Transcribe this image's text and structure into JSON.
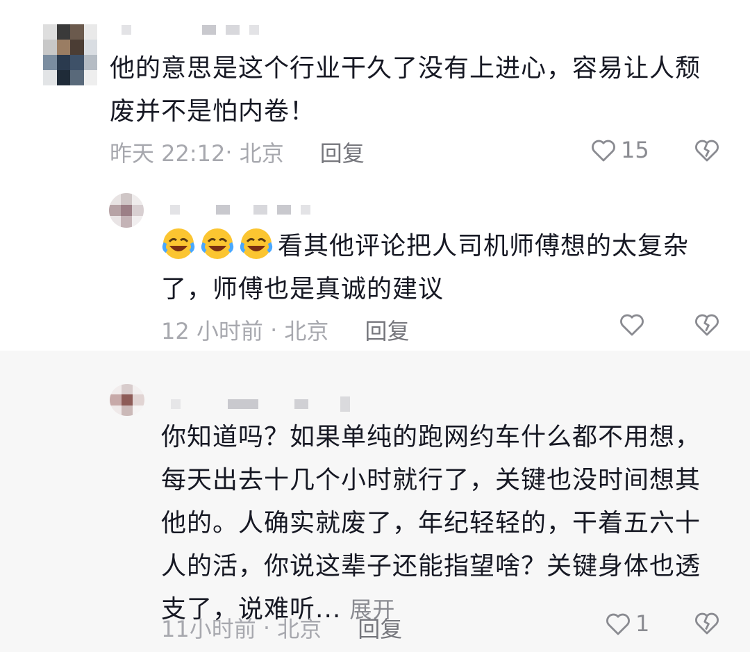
{
  "comments": [
    {
      "text": "他的意思是这个行业干久了没有上进心，容易让人颓废并不是怕内卷！",
      "time": "昨天 22:12",
      "location": "北京",
      "reply_label": "回复",
      "like_count": "15",
      "like_icon": "heart-outline-icon",
      "dislike_icon": "broken-heart-icon"
    },
    {
      "emojis": [
        "laughing-crying-emoji",
        "laughing-crying-emoji",
        "laughing-crying-emoji"
      ],
      "text": "看其他评论把人司机师傅想的太复杂了，师傅也是真诚的建议",
      "time": "12 小时前",
      "location": "北京",
      "reply_label": "回复",
      "like_count": "",
      "like_icon": "heart-outline-icon",
      "dislike_icon": "broken-heart-icon"
    },
    {
      "text": "你知道吗？如果单纯的跑网约车什么都不用想，每天出去十几个小时就行了，关键也没时间想其他的。人确实就废了，年纪轻轻的，干着五六十人的活，你说这辈子还能指望啥？关键身体也透支了，说难听...",
      "expand_label": "展开",
      "time": "11小时前",
      "location": "北京",
      "reply_label": "回复",
      "like_count": "1",
      "like_icon": "heart-outline-icon",
      "dislike_icon": "broken-heart-icon"
    }
  ],
  "colors": {
    "text": "#161823",
    "meta": "#a7a8ae",
    "reply": "#75767c",
    "background_highlight": "#f7f7f7"
  }
}
